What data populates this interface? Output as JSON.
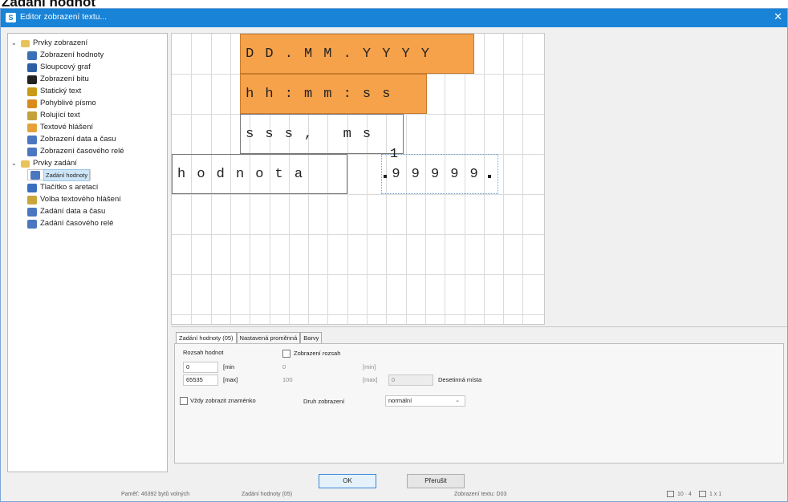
{
  "heading": "Zadání hodnot",
  "window": {
    "title": "Editor zobrazení textu...",
    "close": "✕"
  },
  "tree": {
    "groups": [
      {
        "label": "Prvky zobrazení",
        "items": [
          "Zobrazení hodnoty",
          "Sloupcový graf",
          "Zobrazení bitu",
          "Statický text",
          "Pohyblivé písmo",
          "Rolující text",
          "Textové hlášení",
          "Zobrazení data a času",
          "Zobrazení časového relé"
        ]
      },
      {
        "label": "Prvky zadání",
        "items": [
          "Zadání hodnoty",
          "Tlačítko s aretací",
          "Volba textového hlášení",
          "Zadání data a času",
          "Zadání časového relé"
        ]
      }
    ],
    "selected": "Zadání hodnoty"
  },
  "canvas": {
    "row1": [
      "D",
      "D",
      ".",
      "M",
      "M",
      ".",
      "Y",
      "Y",
      "Y",
      "Y"
    ],
    "row2": [
      "h",
      "h",
      ":",
      "m",
      "m",
      ":",
      "s",
      "s"
    ],
    "row3": [
      "s",
      "s",
      "s",
      ",",
      "",
      "m",
      "s"
    ],
    "row4_label": [
      "h",
      "o",
      "d",
      "n",
      "o",
      "t",
      "a"
    ],
    "row4_value": [
      "9",
      "9",
      "9",
      "9",
      "9"
    ],
    "index_marker": "1"
  },
  "tabs": [
    "Zadání hodnoty (05)",
    "Nastavená proměnná",
    "Barvy"
  ],
  "form": {
    "range_label": "Rozsah hodnot",
    "min_value": "0",
    "max_value": "65535",
    "min_unit": "[min",
    "max_unit": "[max]",
    "show_range_label": "Zobrazení rozsah",
    "show_min_value": "0",
    "show_max_value": "100",
    "show_min_unit": "[min]",
    "show_max_unit": "[max]",
    "decimals_value": "0",
    "decimals_label": "Desetinná místa",
    "always_sign_label": "Vždy zobrazit znaménko",
    "display_type_label": "Druh zobrazení",
    "display_type_value": "normální"
  },
  "buttons": {
    "ok": "OK",
    "cancel": "Přerušit"
  },
  "status": {
    "memory": "Paměť: 46392 bytů volných",
    "element": "Zadání hodnoty (05)",
    "view": "Zobrazení textu: D03",
    "grid": "10 · 4",
    "zoom": "1 x 1"
  },
  "colors": {
    "accent": "#1883d7",
    "highlight": "#f5a24b"
  }
}
